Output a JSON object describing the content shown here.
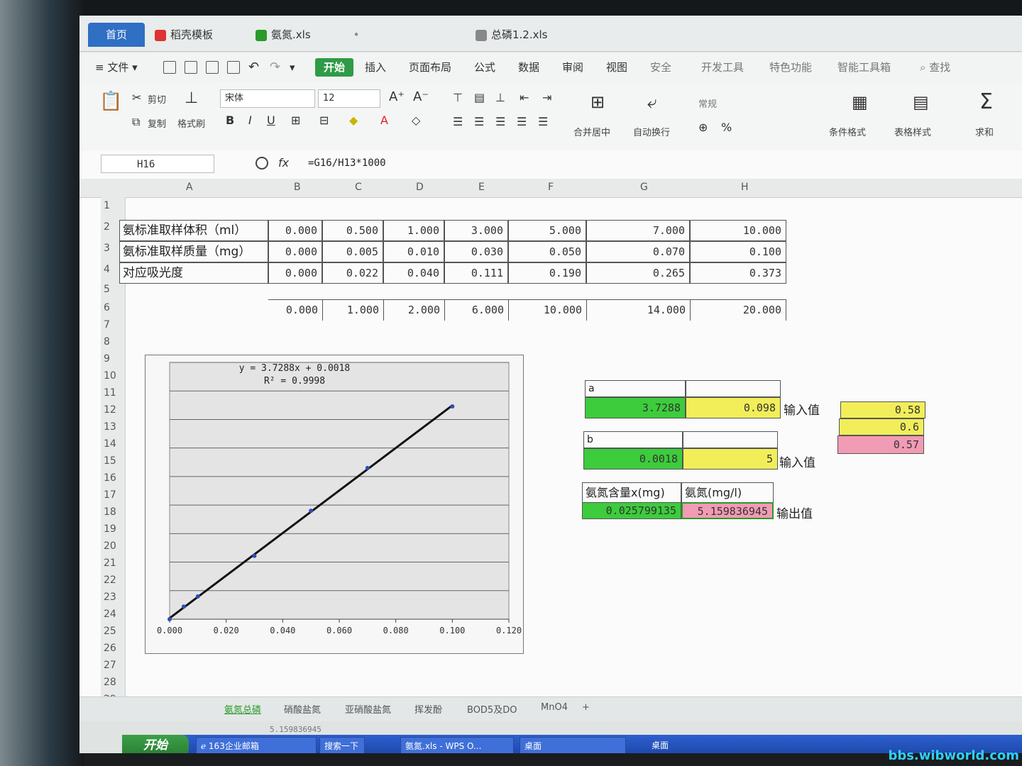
{
  "tabs": [
    {
      "label": "首页"
    },
    {
      "label": "稻壳模板"
    },
    {
      "label": "氨氮.xls"
    },
    {
      "label": "总磷1.2.xls"
    }
  ],
  "menus": [
    "文件",
    "开始",
    "插入",
    "页面布局",
    "公式",
    "数据",
    "审阅",
    "视图",
    "安全",
    "开发工具",
    "特色功能",
    "智能工具箱",
    "查找"
  ],
  "ribbon": {
    "cut": "剪切",
    "copy": "复制",
    "format_painter": "格式刷",
    "font": "宋体",
    "size": "12",
    "merge_center": "合并居中",
    "wrap": "自动换行",
    "general": "常规",
    "cond_format": "条件格式",
    "table_style": "表格样式",
    "sum": "求和"
  },
  "formula_bar": {
    "cell_ref": "H16",
    "fx": "fx",
    "formula": "=G16/H13*1000"
  },
  "columns": [
    "A",
    "B",
    "C",
    "D",
    "E",
    "F",
    "G",
    "H"
  ],
  "rows": [
    "1",
    "2",
    "3",
    "4",
    "5",
    "6",
    "7",
    "8",
    "9",
    "10",
    "11",
    "12",
    "13",
    "14",
    "15",
    "16",
    "17",
    "18",
    "19",
    "20",
    "21",
    "22",
    "23",
    "24",
    "25",
    "26",
    "27",
    "28",
    "29"
  ],
  "table": {
    "row_labels": [
      "氨标准取样体积（ml）",
      "氨标准取样质量（mg）",
      "对应吸光度"
    ],
    "volume": [
      "0.000",
      "0.500",
      "1.000",
      "3.000",
      "5.000",
      "7.000",
      "10.000"
    ],
    "mass": [
      "0.000",
      "0.005",
      "0.010",
      "0.030",
      "0.050",
      "0.070",
      "0.100"
    ],
    "absorbance": [
      "0.000",
      "0.022",
      "0.040",
      "0.111",
      "0.190",
      "0.265",
      "0.373"
    ],
    "row7": [
      "0.000",
      "1.000",
      "2.000",
      "6.000",
      "10.000",
      "14.000",
      "20.000"
    ]
  },
  "calc": {
    "a_label": "a",
    "a_value": "3.7288",
    "a_input": "0.098",
    "b_label": "b",
    "b_value": "0.0018",
    "b_input": "5",
    "input_label": "输入值",
    "x_header": "氨氮含量x(mg)",
    "conc_header": "氨氮(mg/l)",
    "x_value": "0.025799135",
    "conc_value": "5.159836945",
    "output_label": "输出值",
    "side_values": [
      "0.58",
      "0.6",
      "0.57"
    ]
  },
  "chart_data": {
    "type": "scatter",
    "title": "",
    "trendline_equation": "y = 3.7288x + 0.0018",
    "r_squared": "R² = 0.9998",
    "x": [
      0.0,
      0.005,
      0.01,
      0.03,
      0.05,
      0.07,
      0.1
    ],
    "y": [
      0.0,
      0.022,
      0.04,
      0.111,
      0.19,
      0.265,
      0.373
    ],
    "trendline": {
      "slope": 3.7288,
      "intercept": 0.0018
    },
    "x_ticks": [
      "0.000",
      "0.020",
      "0.040",
      "0.060",
      "0.080",
      "0.100",
      "0.120"
    ],
    "xlim": [
      0,
      0.12
    ],
    "ylim": [
      0,
      0.45
    ],
    "grid": true,
    "legend": "none"
  },
  "sheet_tabs": [
    "氨氮总磷",
    "硝酸盐氮",
    "亚硝酸盐氮",
    "挥发酚",
    "BOD5及DO",
    "MnO4"
  ],
  "status_number": "5.159836945",
  "taskbar": {
    "start": "开始",
    "items": [
      "163企业邮箱",
      "搜索一下",
      "氨氮.xls - WPS O...",
      "桌面",
      "桌面"
    ]
  },
  "watermark": "bbs.wibworld.com"
}
